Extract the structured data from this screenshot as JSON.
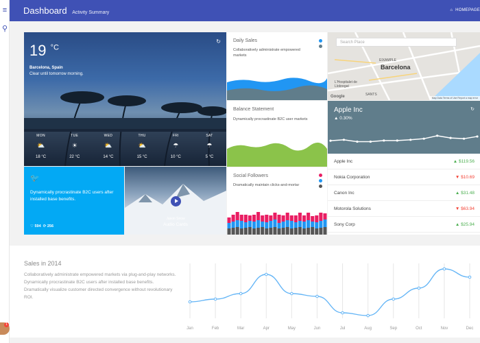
{
  "header": {
    "title": "Dashboard",
    "subtitle": "Activity Summary",
    "home_label": "HOMEPAGE"
  },
  "weather": {
    "temp": "19",
    "unit": "°C",
    "location": "Barcelona, Spain",
    "description": "Clear until tomorrow morning.",
    "forecast": [
      {
        "day": "MON",
        "temp": "18 °C",
        "icon": "cloud-sun-icon",
        "glyph": "⛅"
      },
      {
        "day": "TUE",
        "temp": "22 °C",
        "icon": "sun-icon",
        "glyph": "☀"
      },
      {
        "day": "WED",
        "temp": "14 °C",
        "icon": "cloud-sun-icon",
        "glyph": "⛅"
      },
      {
        "day": "THU",
        "temp": "15 °C",
        "icon": "cloud-sun-icon",
        "glyph": "⛅"
      },
      {
        "day": "FRI",
        "temp": "10 °C",
        "icon": "rain-icon",
        "glyph": "☂"
      },
      {
        "day": "SAT",
        "temp": "5 °C",
        "icon": "rain-icon",
        "glyph": "☂"
      }
    ]
  },
  "daily_sales": {
    "title": "Daily Sales",
    "text": "Collaboratively administrate empowered markets",
    "colors": [
      "#2196f3",
      "#607d8b"
    ]
  },
  "balance": {
    "title": "Balance Statement",
    "text": "Dynamically procrastinate B2C user markets",
    "color": "#8bc34a"
  },
  "followers": {
    "title": "Social Followers",
    "text": "Dramatically maintain clicks-and-mortar",
    "colors": [
      "#e91e63",
      "#2196f3",
      "#555555"
    ]
  },
  "map": {
    "search_placeholder": "Search Place",
    "city": "Barcelona",
    "labels": [
      "EIXAMPLE",
      "L'Hospitalet de Llobregat",
      "SANTS"
    ],
    "google": "Google",
    "footer": "Map Data   Terms of Use   Report a map error"
  },
  "stock": {
    "name": "Apple Inc",
    "change": "▲ 0.30%",
    "chart_values": [
      0.55,
      0.6,
      0.5,
      0.5,
      0.56,
      0.56,
      0.6,
      0.66,
      0.82,
      0.7,
      0.66,
      0.78
    ],
    "rows": [
      {
        "name": "Apple Inc",
        "value": "▲ $119.56",
        "dir": "up"
      },
      {
        "name": "Nokia Corporation",
        "value": "▼ $10.69",
        "dir": "down"
      },
      {
        "name": "Canon Inc",
        "value": "▲ $31.48",
        "dir": "up"
      },
      {
        "name": "Motorola Solutions",
        "value": "▼ $63.94",
        "dir": "down"
      },
      {
        "name": "Sony Corp",
        "value": "▲ $25.94",
        "dir": "up"
      }
    ]
  },
  "twitter": {
    "text": "Dynamically procrastinate B2C users after installed base benefits.",
    "likes": "594",
    "retweets": "256"
  },
  "video": {
    "author": "Jason Snow",
    "title": "Audio Cards"
  },
  "sales": {
    "title": "Sales in 2014",
    "text": "Collaboratively administrate empowered markets via plug-and-play networks. Dynamically procrastinate B2C users after installed base benefits. Dramatically visualize customer directed convergence without revolutionary ROI."
  },
  "avatar": {
    "badge": "1"
  },
  "chart_data": {
    "type": "line",
    "categories": [
      "Jan",
      "Feb",
      "Mar",
      "Apr",
      "May",
      "Jun",
      "Jul",
      "Aug",
      "Sep",
      "Oct",
      "Nov",
      "Dec"
    ],
    "values": [
      30,
      35,
      45,
      80,
      45,
      40,
      10,
      5,
      35,
      55,
      90,
      75
    ],
    "ylim": [
      0,
      100
    ],
    "grid": true,
    "color": "#64b5f6"
  }
}
